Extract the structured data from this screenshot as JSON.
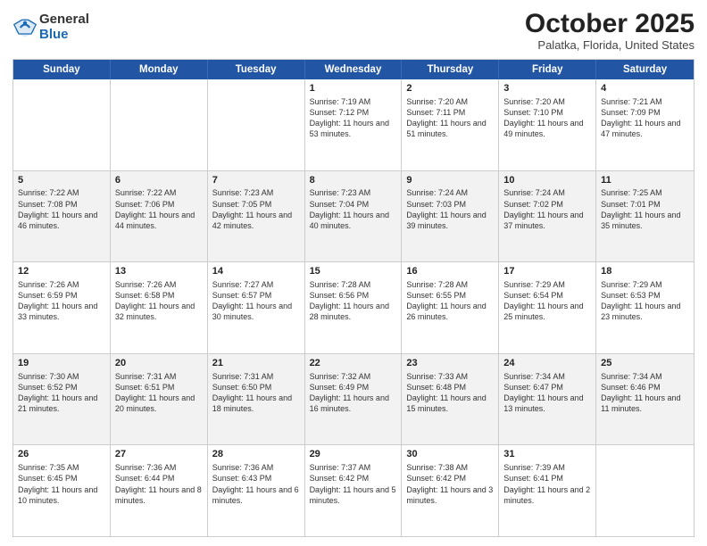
{
  "header": {
    "logo_general": "General",
    "logo_blue": "Blue",
    "month_title": "October 2025",
    "location": "Palatka, Florida, United States"
  },
  "weekdays": [
    "Sunday",
    "Monday",
    "Tuesday",
    "Wednesday",
    "Thursday",
    "Friday",
    "Saturday"
  ],
  "rows": [
    [
      {
        "day": "",
        "text": ""
      },
      {
        "day": "",
        "text": ""
      },
      {
        "day": "",
        "text": ""
      },
      {
        "day": "1",
        "text": "Sunrise: 7:19 AM\nSunset: 7:12 PM\nDaylight: 11 hours\nand 53 minutes."
      },
      {
        "day": "2",
        "text": "Sunrise: 7:20 AM\nSunset: 7:11 PM\nDaylight: 11 hours\nand 51 minutes."
      },
      {
        "day": "3",
        "text": "Sunrise: 7:20 AM\nSunset: 7:10 PM\nDaylight: 11 hours\nand 49 minutes."
      },
      {
        "day": "4",
        "text": "Sunrise: 7:21 AM\nSunset: 7:09 PM\nDaylight: 11 hours\nand 47 minutes."
      }
    ],
    [
      {
        "day": "5",
        "text": "Sunrise: 7:22 AM\nSunset: 7:08 PM\nDaylight: 11 hours\nand 46 minutes."
      },
      {
        "day": "6",
        "text": "Sunrise: 7:22 AM\nSunset: 7:06 PM\nDaylight: 11 hours\nand 44 minutes."
      },
      {
        "day": "7",
        "text": "Sunrise: 7:23 AM\nSunset: 7:05 PM\nDaylight: 11 hours\nand 42 minutes."
      },
      {
        "day": "8",
        "text": "Sunrise: 7:23 AM\nSunset: 7:04 PM\nDaylight: 11 hours\nand 40 minutes."
      },
      {
        "day": "9",
        "text": "Sunrise: 7:24 AM\nSunset: 7:03 PM\nDaylight: 11 hours\nand 39 minutes."
      },
      {
        "day": "10",
        "text": "Sunrise: 7:24 AM\nSunset: 7:02 PM\nDaylight: 11 hours\nand 37 minutes."
      },
      {
        "day": "11",
        "text": "Sunrise: 7:25 AM\nSunset: 7:01 PM\nDaylight: 11 hours\nand 35 minutes."
      }
    ],
    [
      {
        "day": "12",
        "text": "Sunrise: 7:26 AM\nSunset: 6:59 PM\nDaylight: 11 hours\nand 33 minutes."
      },
      {
        "day": "13",
        "text": "Sunrise: 7:26 AM\nSunset: 6:58 PM\nDaylight: 11 hours\nand 32 minutes."
      },
      {
        "day": "14",
        "text": "Sunrise: 7:27 AM\nSunset: 6:57 PM\nDaylight: 11 hours\nand 30 minutes."
      },
      {
        "day": "15",
        "text": "Sunrise: 7:28 AM\nSunset: 6:56 PM\nDaylight: 11 hours\nand 28 minutes."
      },
      {
        "day": "16",
        "text": "Sunrise: 7:28 AM\nSunset: 6:55 PM\nDaylight: 11 hours\nand 26 minutes."
      },
      {
        "day": "17",
        "text": "Sunrise: 7:29 AM\nSunset: 6:54 PM\nDaylight: 11 hours\nand 25 minutes."
      },
      {
        "day": "18",
        "text": "Sunrise: 7:29 AM\nSunset: 6:53 PM\nDaylight: 11 hours\nand 23 minutes."
      }
    ],
    [
      {
        "day": "19",
        "text": "Sunrise: 7:30 AM\nSunset: 6:52 PM\nDaylight: 11 hours\nand 21 minutes."
      },
      {
        "day": "20",
        "text": "Sunrise: 7:31 AM\nSunset: 6:51 PM\nDaylight: 11 hours\nand 20 minutes."
      },
      {
        "day": "21",
        "text": "Sunrise: 7:31 AM\nSunset: 6:50 PM\nDaylight: 11 hours\nand 18 minutes."
      },
      {
        "day": "22",
        "text": "Sunrise: 7:32 AM\nSunset: 6:49 PM\nDaylight: 11 hours\nand 16 minutes."
      },
      {
        "day": "23",
        "text": "Sunrise: 7:33 AM\nSunset: 6:48 PM\nDaylight: 11 hours\nand 15 minutes."
      },
      {
        "day": "24",
        "text": "Sunrise: 7:34 AM\nSunset: 6:47 PM\nDaylight: 11 hours\nand 13 minutes."
      },
      {
        "day": "25",
        "text": "Sunrise: 7:34 AM\nSunset: 6:46 PM\nDaylight: 11 hours\nand 11 minutes."
      }
    ],
    [
      {
        "day": "26",
        "text": "Sunrise: 7:35 AM\nSunset: 6:45 PM\nDaylight: 11 hours\nand 10 minutes."
      },
      {
        "day": "27",
        "text": "Sunrise: 7:36 AM\nSunset: 6:44 PM\nDaylight: 11 hours\nand 8 minutes."
      },
      {
        "day": "28",
        "text": "Sunrise: 7:36 AM\nSunset: 6:43 PM\nDaylight: 11 hours\nand 6 minutes."
      },
      {
        "day": "29",
        "text": "Sunrise: 7:37 AM\nSunset: 6:42 PM\nDaylight: 11 hours\nand 5 minutes."
      },
      {
        "day": "30",
        "text": "Sunrise: 7:38 AM\nSunset: 6:42 PM\nDaylight: 11 hours\nand 3 minutes."
      },
      {
        "day": "31",
        "text": "Sunrise: 7:39 AM\nSunset: 6:41 PM\nDaylight: 11 hours\nand 2 minutes."
      },
      {
        "day": "",
        "text": ""
      }
    ]
  ]
}
